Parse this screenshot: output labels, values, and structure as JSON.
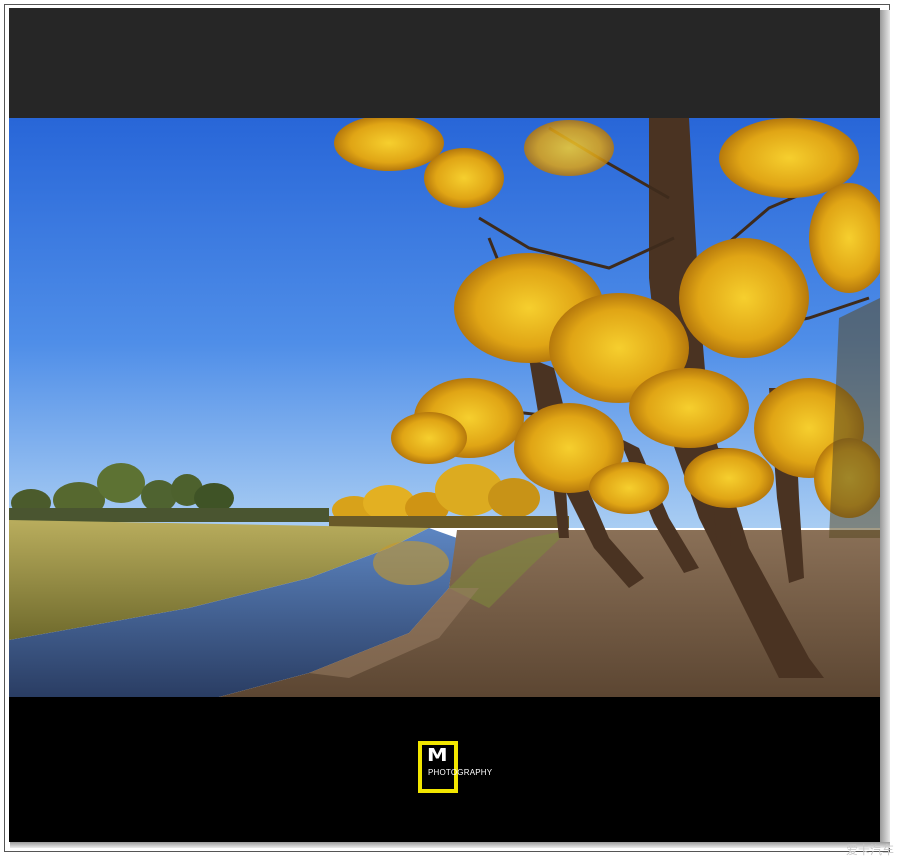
{
  "logo": {
    "mark": "M",
    "text": "PHOTOGRAPHY",
    "accent_color": "#f2e600"
  },
  "watermark": {
    "text": "爱卡汽车"
  },
  "scene": {
    "subject": "autumn-poplar-trees-by-river",
    "sky_color": "#3f7fe0",
    "foliage_color": "#e8b31a"
  }
}
